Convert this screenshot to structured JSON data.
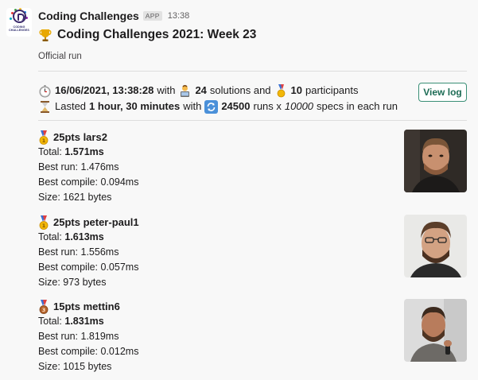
{
  "app": {
    "name": "Coding Challenges",
    "badge": "APP",
    "time": "13:38",
    "logo_text_1": "CODING",
    "logo_text_2": "CHALLENGES"
  },
  "message": {
    "title": "Coding Challenges 2021: Week 23",
    "subtitle": "Official run",
    "run": {
      "datetime": "16/06/2021, 13:38:28",
      "with": "with",
      "solutions_count": "24",
      "solutions_label": "solutions and",
      "participants_count": "10",
      "participants_label": "participants",
      "lasted_label": "Lasted",
      "duration": "1 hour, 30 minutes",
      "with2": "with",
      "runs_count": "24500",
      "runs_label": "runs x",
      "specs_count": "10000",
      "specs_label": "specs in each run"
    },
    "view_log_label": "View log"
  },
  "results": [
    {
      "medal": "gold",
      "points_name": "25pts lars2",
      "total_label": "Total:",
      "total": "1.571ms",
      "best_run": "Best run: 1.476ms",
      "best_compile": "Best compile: 0.094ms",
      "size": "Size: 1621 bytes"
    },
    {
      "medal": "gold",
      "points_name": "25pts peter-paul1",
      "total_label": "Total:",
      "total": "1.613ms",
      "best_run": "Best run: 1.556ms",
      "best_compile": "Best compile: 0.057ms",
      "size": "Size: 973 bytes"
    },
    {
      "medal": "bronze",
      "points_name": "15pts mettin6",
      "total_label": "Total:",
      "total": "1.831ms",
      "best_run": "Best run: 1.819ms",
      "best_compile": "Best compile: 0.012ms",
      "size": "Size: 1015 bytes"
    }
  ],
  "colors": {
    "button_border": "#3a8f76",
    "button_text": "#1d6c55",
    "gold": "#f2b707",
    "bronze": "#b4632c",
    "divider": "#dddddd"
  },
  "icons": [
    "trophy-icon",
    "stopwatch-icon",
    "technologist-icon",
    "medal-icon",
    "hourglass-icon",
    "repeat-icon",
    "gold-medal-icon",
    "bronze-medal-icon"
  ]
}
